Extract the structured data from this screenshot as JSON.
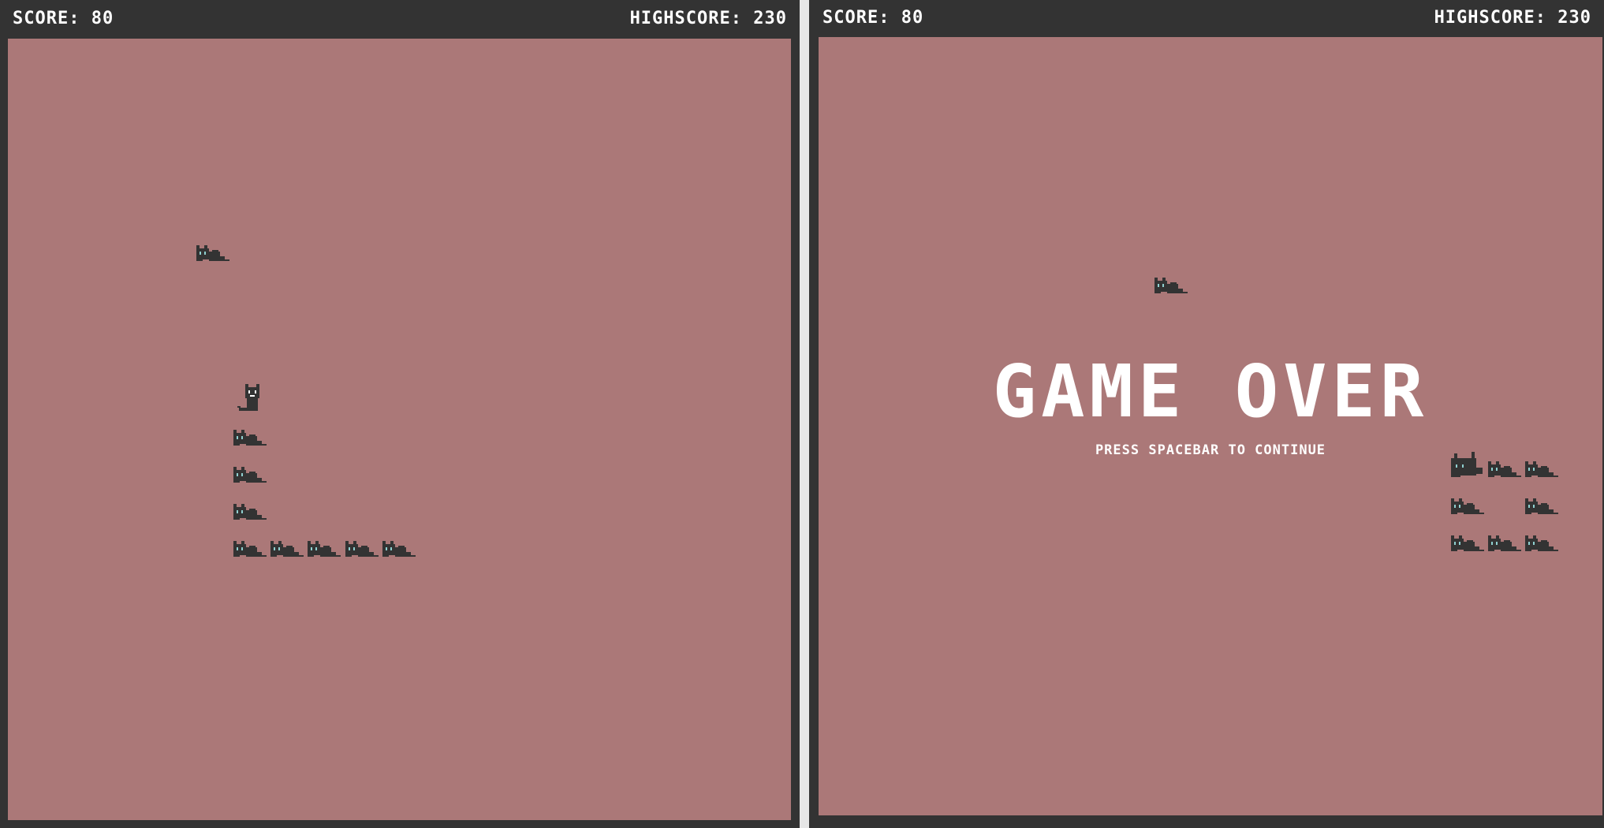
{
  "colors": {
    "frame": "#333333",
    "field": "#ab7878",
    "text": "#ffffff",
    "sprite": "#333333",
    "sprite_eye": "#8fd0d0"
  },
  "left_screen": {
    "score_label": "SCORE: 80",
    "highscore_label": "HIGHSCORE: 230"
  },
  "right_screen": {
    "score_label": "SCORE: 80",
    "highscore_label": "HIGHSCORE: 230",
    "title": "GAME OVER",
    "subtitle": "PRESS SPACEBAR TO CONTINUE"
  },
  "sprites": {
    "head": "cat-head-icon",
    "segment": "cat-lying-icon",
    "food": "cat-food-icon"
  }
}
